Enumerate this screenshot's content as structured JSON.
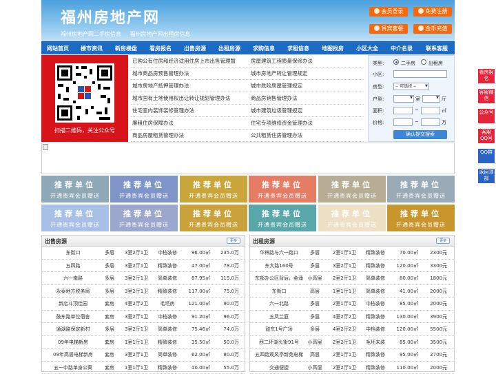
{
  "header": {
    "title": "福州房地产网",
    "subtitle_links": [
      "福州房地产网二手房信息",
      "福州房地产网出租房信息"
    ],
    "buttons": [
      "会员登录",
      "免费注册",
      "贵宾套餐",
      "金币充值"
    ]
  },
  "nav": [
    "网站首页",
    "楼市资讯",
    "新房楼盘",
    "看房报名",
    "出售房源",
    "出租房源",
    "求购信息",
    "求租信息",
    "地图找房",
    "小区大全",
    "中介名录",
    "联系客服"
  ],
  "qr": {
    "caption": "扫描二维码，关注公众号"
  },
  "links": [
    [
      "已购公有住房和经济适用住房上市出售管理暂",
      "房屋建筑工程质量保修办法"
    ],
    [
      "城市商品房预售管理办法",
      "城市房地产转让管理规定"
    ],
    [
      "城市房地产抵押管理办法",
      "城市危险房屋管理规定"
    ],
    [
      "城市国有土地使用权出让转让规划管理办法",
      "商品房销售管理办法"
    ],
    [
      "住宅室内装饰装修管理办法",
      "城市建筑垃圾管理规定"
    ],
    [
      "廉租住房保障办法",
      "住宅专项维修资金管理办法"
    ],
    [
      "商品房屋租赁管理办法",
      "公共租赁住房管理办法"
    ]
  ],
  "search": {
    "type_label": "类型:",
    "type_options": [
      "二手房",
      "出租房"
    ],
    "community_label": "小区:",
    "housing_label": "房型:",
    "housing_select": "-- 可选择 --",
    "layout_label": "户型:",
    "room_unit": "室",
    "hall_unit": "厅",
    "area_label": "面积:",
    "area_sep": "~",
    "area_unit": "㎡",
    "price_label": "价格:",
    "price_sep": "~",
    "price_unit": "万",
    "submit": "确认提交搜索"
  },
  "recommend": {
    "line1": "推荐单位",
    "line2": "开通贵宾会员赠送",
    "colors": [
      "#8fa9b8",
      "#7f95c9",
      "#c9a53a",
      "#e57c63",
      "#b7ad94",
      "#9aaab6",
      "#a9c0e6",
      "#9ba7cc",
      "#caa23c",
      "#5aa7aa",
      "#ede0c4",
      "#c9962e"
    ]
  },
  "sale": {
    "title": "出售房源",
    "more": "更多",
    "rows": [
      [
        "东街口",
        "多层",
        "3室2厅1卫",
        "中档装修",
        "96.00㎡",
        "235.0万"
      ],
      [
        "五四路",
        "多层",
        "3室2厅1卫",
        "精致装修",
        "47.00㎡",
        "78.0万"
      ],
      [
        "六一南路",
        "多层",
        "3室2厅1卫",
        "简单装修",
        "87.95㎡",
        "115.0万"
      ],
      [
        "永泰地方税务局",
        "多层",
        "3室2厅1卫",
        "精致装修",
        "117.00㎡",
        "75.0万"
      ],
      [
        "新店斗顶佳园",
        "套房",
        "4室2厅2卫",
        "毛坯房",
        "121.00㎡",
        "90.0万"
      ],
      [
        "鼓东路单位宿舍",
        "套房",
        "3室2厅1卫",
        "中档装修",
        "91.20㎡",
        "96.0万"
      ],
      [
        "通湖路保定新村",
        "多层",
        "3室2厅1卫",
        "简单装修",
        "75.46㎡",
        "74.0万"
      ],
      [
        "09年电梯新房",
        "套房",
        "1室1厅1卫",
        "精致装修",
        "35.50㎡",
        "50.0万"
      ],
      [
        "09年高层电梯新房",
        "套房",
        "3室2厅1卫",
        "简单装修",
        "62.00㎡",
        "80.0万"
      ],
      [
        "五一中路单身公寓",
        "套房",
        "1室1厅1卫",
        "精致装修",
        "40.00㎡",
        "55.0万"
      ]
    ]
  },
  "rent": {
    "title": "出租房源",
    "more": "更多",
    "rows": [
      [
        "华林路与六一路口",
        "多层",
        "2室1厅1卫",
        "精致装修",
        "70.00㎡",
        "2300元"
      ],
      [
        "东大路160号",
        "多层",
        "3室2厅1卫",
        "精致装修",
        "120.00㎡",
        "3300元"
      ],
      [
        "东部办公区背后，金涌",
        "小高层",
        "2室2厅1卫",
        "简单装修",
        "80.00㎡",
        "1800元"
      ],
      [
        "东街口",
        "高层",
        "1室1厅1卫",
        "简单装修",
        "41.00㎡",
        "2000元"
      ],
      [
        "六一北路",
        "多层",
        "2室1厅1卫",
        "中档装修",
        "85.00㎡",
        "2000元"
      ],
      [
        "五凤兰庭",
        "多层",
        "4室2厅2卫",
        "精致装修",
        "130.00㎡",
        "3900元"
      ],
      [
        "鼓东1号广场",
        "多层",
        "4室2厅2卫",
        "中档装修",
        "120.00㎡",
        "5500元"
      ],
      [
        "西二环湖头街91号",
        "小高层",
        "2室2厅1卫",
        "毛坯未装",
        "85.00㎡",
        "3500元"
      ],
      [
        "五四路观风亭新苑电梯",
        "高层",
        "2室1厅1卫",
        "精致装修",
        "95.00㎡",
        "2700元"
      ],
      [
        "交通便捷",
        "小高层",
        "2室2厅1卫",
        "精致装修",
        "110.00㎡",
        "2000元"
      ]
    ]
  },
  "side": [
    "看房报名",
    "客服微信",
    "公众号",
    "客服QQ号",
    "QQ群",
    "返回顶部"
  ]
}
